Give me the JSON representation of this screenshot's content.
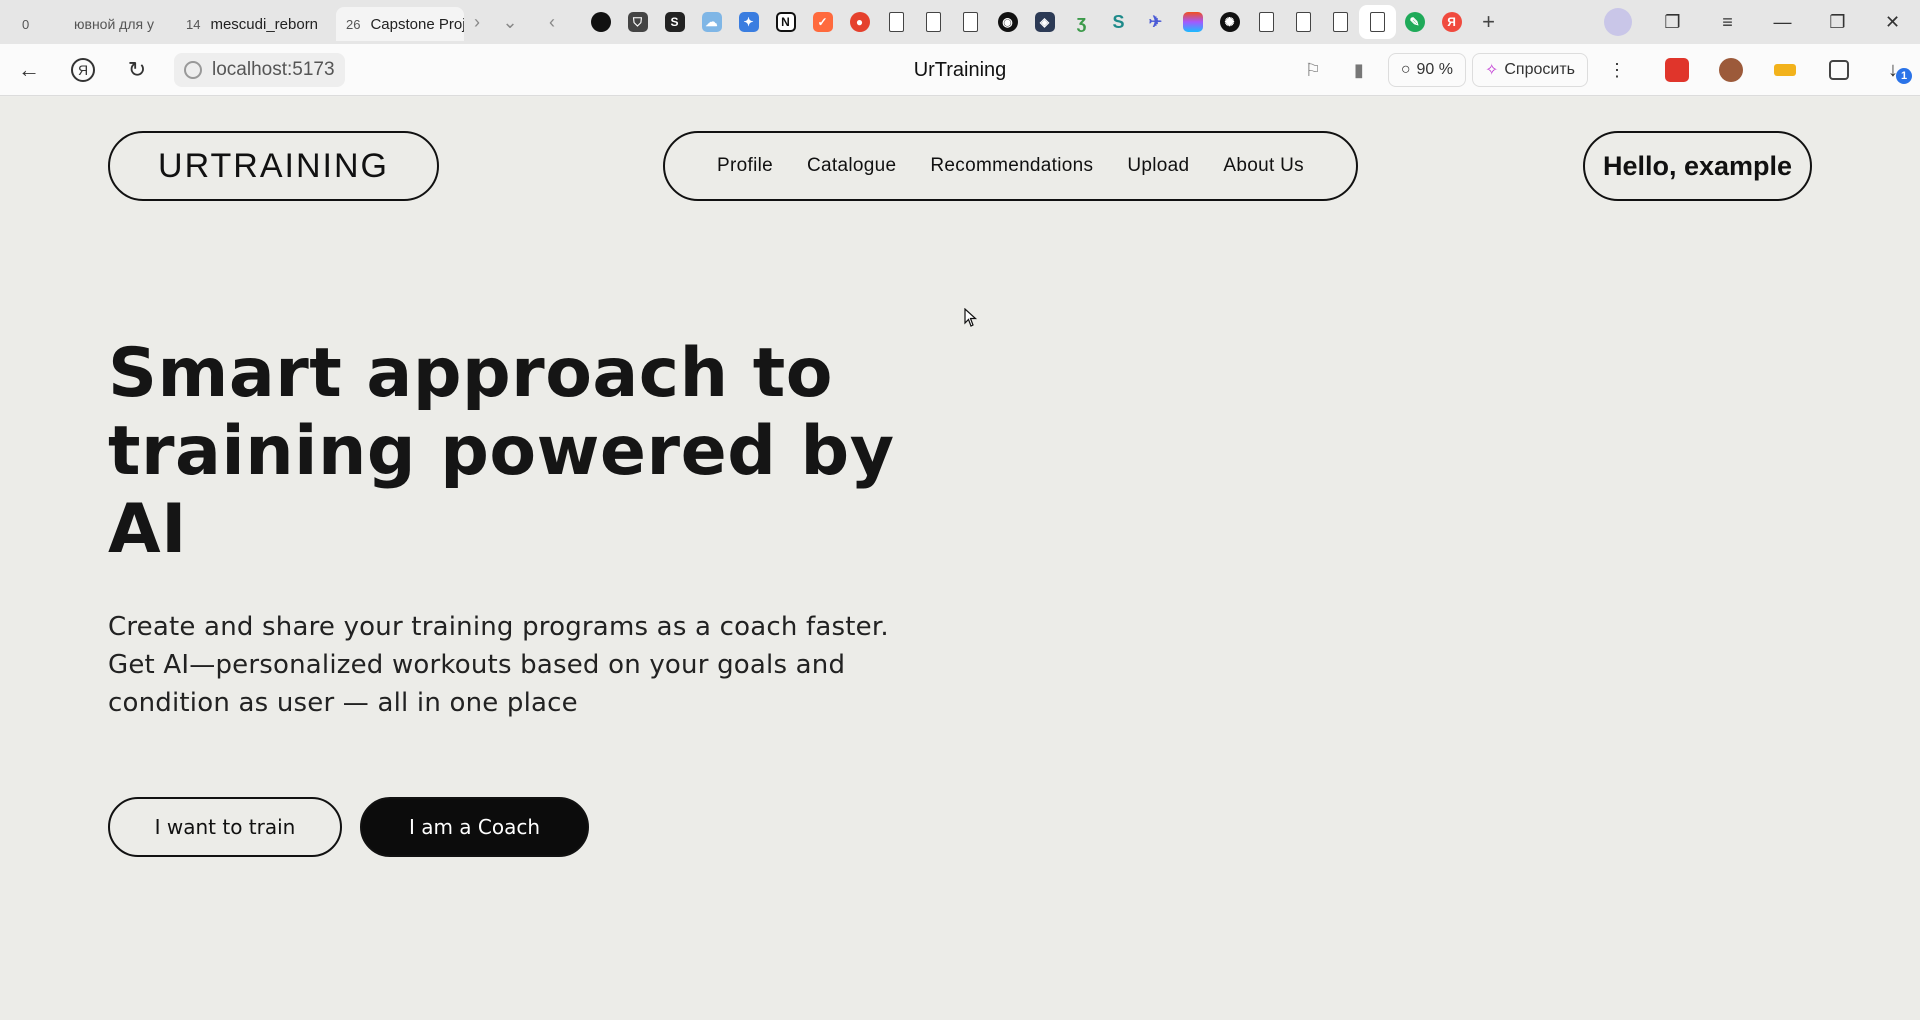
{
  "browser": {
    "tabs": [
      {
        "count": "0",
        "label": "ювной для у",
        "state": "faded"
      },
      {
        "count": "14",
        "label": "mescudi_reborn",
        "state": "normal"
      },
      {
        "count": "26",
        "label": "Capstone Proj",
        "state": "active"
      }
    ],
    "pinned_icons": [
      "yin-yang-icon",
      "shield-icon",
      "shopify-icon",
      "cloud-icon",
      "puzzle-icon",
      "notion-icon",
      "figma-like-icon",
      "record-icon",
      "file-icon",
      "file-icon",
      "file-icon",
      "github-icon",
      "box-icon",
      "leaf-icon",
      "s-icon",
      "bird-icon",
      "figma-icon",
      "openai-icon",
      "file-icon",
      "file-icon",
      "file-icon",
      "file-icon",
      "green-icon",
      "yandex-icon"
    ],
    "page_title": "UrTraining",
    "url": "localhost:5173",
    "zoom": "90 %",
    "ask_label": "Спросить",
    "download_badge": "1"
  },
  "site": {
    "logo": "URTRAINING",
    "nav": [
      "Profile",
      "Catalogue",
      "Recommendations",
      "Upload",
      "About Us"
    ],
    "greeting": "Hello, example"
  },
  "hero": {
    "title_lines": [
      "Smart approach to",
      "training powered by",
      "AI"
    ],
    "subtitle_lines": [
      "Create and share your training programs as a coach faster.",
      "Get AI—personalized workouts based on your goals and",
      "condition as user — all in one place"
    ],
    "primary_cta": "I want to train",
    "secondary_cta": "I am a Coach"
  },
  "colors": {
    "page_bg": "#ecece8",
    "ink": "#111111",
    "button_dark": "#0c0c0c"
  }
}
